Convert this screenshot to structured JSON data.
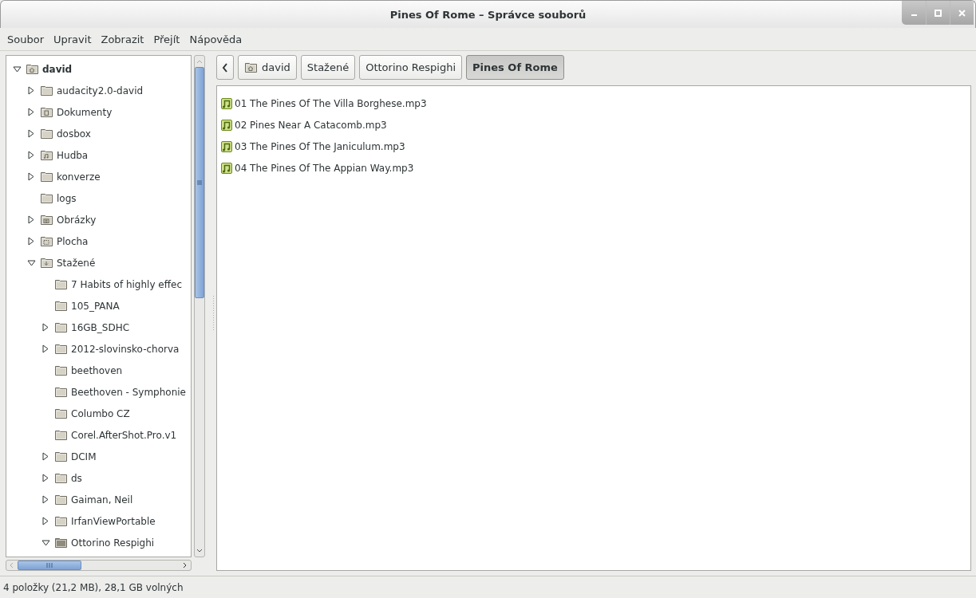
{
  "window": {
    "title": "Pines Of Rome – Správce souborů"
  },
  "menu": [
    "Soubor",
    "Upravit",
    "Zobrazit",
    "Přejít",
    "Nápověda"
  ],
  "sidebar": {
    "tree": [
      {
        "label": "david",
        "kind": "home",
        "expandable": true,
        "expanded": true,
        "children": [
          {
            "label": "audacity2.0-david",
            "kind": "folder",
            "expandable": true,
            "expanded": false
          },
          {
            "label": "Dokumenty",
            "kind": "documents",
            "expandable": true,
            "expanded": false
          },
          {
            "label": "dosbox",
            "kind": "folder",
            "expandable": true,
            "expanded": false
          },
          {
            "label": "Hudba",
            "kind": "music",
            "expandable": true,
            "expanded": false
          },
          {
            "label": "konverze",
            "kind": "folder",
            "expandable": true,
            "expanded": false
          },
          {
            "label": "logs",
            "kind": "folder"
          },
          {
            "label": "Obrázky",
            "kind": "pictures",
            "expandable": true,
            "expanded": false
          },
          {
            "label": "Plocha",
            "kind": "desktop",
            "expandable": true,
            "expanded": false
          },
          {
            "label": "Stažené",
            "kind": "downloads",
            "expandable": true,
            "expanded": true,
            "children": [
              {
                "label": "7 Habits of highly effec",
                "kind": "folder"
              },
              {
                "label": "105_PANA",
                "kind": "folder"
              },
              {
                "label": "16GB_SDHC",
                "kind": "folder",
                "expandable": true,
                "expanded": false
              },
              {
                "label": "2012-slovinsko-chorva",
                "kind": "folder",
                "expandable": true,
                "expanded": false
              },
              {
                "label": "beethoven",
                "kind": "folder"
              },
              {
                "label": "Beethoven - Symphonie",
                "kind": "folder"
              },
              {
                "label": "Columbo CZ",
                "kind": "folder"
              },
              {
                "label": "Corel.AfterShot.Pro.v1",
                "kind": "folder"
              },
              {
                "label": "DCIM",
                "kind": "folder",
                "expandable": true,
                "expanded": false
              },
              {
                "label": "ds",
                "kind": "folder",
                "expandable": true,
                "expanded": false
              },
              {
                "label": "Gaiman, Neil",
                "kind": "folder",
                "expandable": true,
                "expanded": false
              },
              {
                "label": "IrfanViewPortable",
                "kind": "folder",
                "expandable": true,
                "expanded": false
              },
              {
                "label": "Ottorino Respighi",
                "kind": "open-folder",
                "expandable": true,
                "expanded": true
              }
            ]
          }
        ]
      }
    ]
  },
  "pathbar": [
    {
      "label": "david",
      "kind": "home",
      "selected": false
    },
    {
      "label": "Stažené",
      "kind": "plain",
      "selected": false
    },
    {
      "label": "Ottorino Respighi",
      "kind": "plain",
      "selected": false
    },
    {
      "label": "Pines Of Rome",
      "kind": "plain",
      "selected": true
    }
  ],
  "files": [
    "01 The Pines Of The Villa Borghese.mp3",
    "02 Pines Near A Catacomb.mp3",
    "03 The Pines Of The Janiculum.mp3",
    "04 The Pines Of The Appian Way.mp3"
  ],
  "status_bar": "4 položky (21,2 MB), 28,1 GB volných"
}
